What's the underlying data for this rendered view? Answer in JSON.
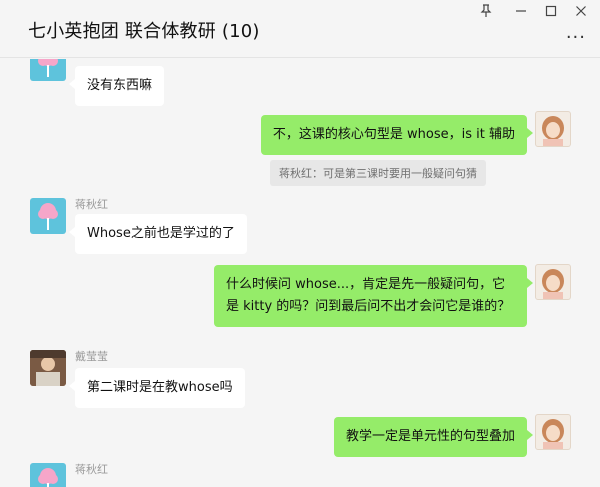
{
  "window": {
    "title": "七小英抱团 联合体教研 (10)",
    "more_glyph": "···"
  },
  "colors": {
    "background": "#f5f5f5",
    "bubble_self": "#95ec69",
    "bubble_other": "#ffffff",
    "quote_bg": "#e7e7e7"
  },
  "messages": [
    {
      "side": "left",
      "sender": "",
      "text": "没有东西嘛",
      "avatar": "cotton-candy-avatar"
    },
    {
      "side": "right",
      "text": "不，这课的核心句型是 whose，is it 辅助",
      "avatar": "girl-avatar"
    },
    {
      "side": "quote",
      "text": "蒋秋红：可是第三课时要用一般疑问句猜"
    },
    {
      "side": "left",
      "sender": "蒋秋红",
      "text": "Whose之前也是学过的了",
      "avatar": "cotton-candy-avatar"
    },
    {
      "side": "right",
      "text": "什么时候问 whose...，肯定是先一般疑问句，它是 kitty 的吗？问到最后问不出才会问它是谁的？",
      "avatar": "girl-avatar"
    },
    {
      "side": "left",
      "sender": "戴莹莹",
      "text": "第二课时是在教whose吗",
      "avatar": "photo-avatar"
    },
    {
      "side": "right",
      "text": "教学一定是单元性的句型叠加",
      "avatar": "girl-avatar"
    },
    {
      "side": "left",
      "sender": "蒋秋红",
      "text": "",
      "avatar": "cotton-candy-avatar"
    }
  ]
}
